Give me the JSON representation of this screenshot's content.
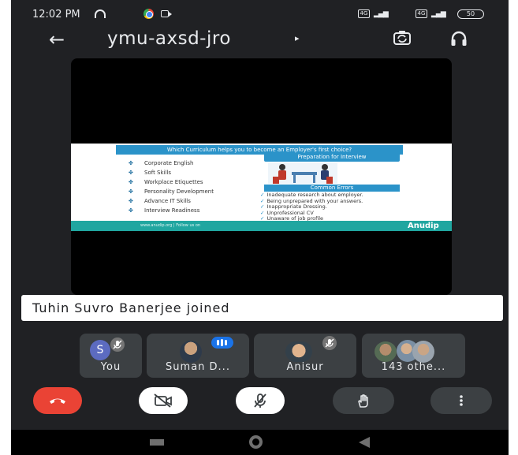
{
  "status_bar": {
    "time": "12:02 PM",
    "sim1_label": "4G",
    "sim2_label": "4G",
    "signal_glyph": "▂▄▆",
    "battery_label": "50"
  },
  "header": {
    "meeting_code": "ymu-axsd-jro",
    "caret": "▸"
  },
  "slide": {
    "title": "Which Curriculum helps you to become an Employer's first choice?",
    "curriculum_bullet": "✤",
    "curriculum_items": [
      "Corporate English",
      "Soft Skills",
      "Workplace Etiquettes",
      "Personality Development",
      "Advance IT Skills",
      "Interview Readiness"
    ],
    "preparation_heading": "Preparation for Interview",
    "errors_heading": "Common Errors",
    "check_glyph": "✓",
    "errors": [
      "Inadequate research about employer.",
      "Being unprepared with your answers.",
      "Inappropriate Dressing.",
      "Unprofessional CV",
      "Unaware of job profile"
    ],
    "brand": "Anudip",
    "footer_text": "www.anudip.org | Follow us on"
  },
  "toast": {
    "message": "Tuhin Suvro Banerjee joined"
  },
  "participants": [
    {
      "label": "You",
      "avatar_letter": "S",
      "muted": true
    },
    {
      "label": "Suman D...",
      "speaking": true
    },
    {
      "label": "Anisur",
      "muted": true
    },
    {
      "label": "143 othe..."
    }
  ],
  "icons": {
    "back": "arrow-left-icon",
    "switch_camera": "switch-camera-icon",
    "audio_output": "headphones-icon",
    "end_call": "phone-hangup-icon",
    "camera": "video-off-icon",
    "mic": "mic-off-icon",
    "raise_hand": "hand-icon",
    "more": "more-vert-icon",
    "mic_off_glyph": "🎙"
  },
  "colors": {
    "background": "#202124",
    "end_call": "#ea4335",
    "accent": "#1a73e8",
    "tile": "#3c4043"
  }
}
